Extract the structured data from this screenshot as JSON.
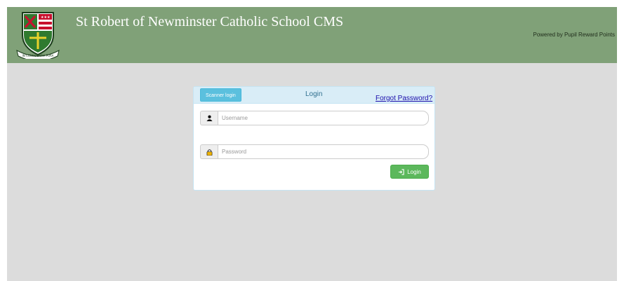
{
  "header": {
    "title": "St Robert of Newminster Catholic School CMS",
    "powered_by": "Powered by Pupil Reward Points",
    "crest_motto": "IN CONSCIENTIA PURA"
  },
  "login_panel": {
    "scanner_button": "Scanner login",
    "title": "Login",
    "forgot_link": "Forgot Password?",
    "username": {
      "placeholder": "Username",
      "value": "",
      "icon": "user-icon"
    },
    "password": {
      "placeholder": "Password",
      "value": "",
      "icon": "lock-icon"
    },
    "login_button": "Login",
    "login_icon": "login-arrow-icon"
  },
  "colors": {
    "header_bg": "#80a178",
    "page_bg": "#dcdcdc",
    "panel_head_bg": "#d9edf7",
    "scanner_button_bg": "#5bc0de",
    "login_button_bg": "#5cb85c",
    "link": "#1a0dab"
  }
}
